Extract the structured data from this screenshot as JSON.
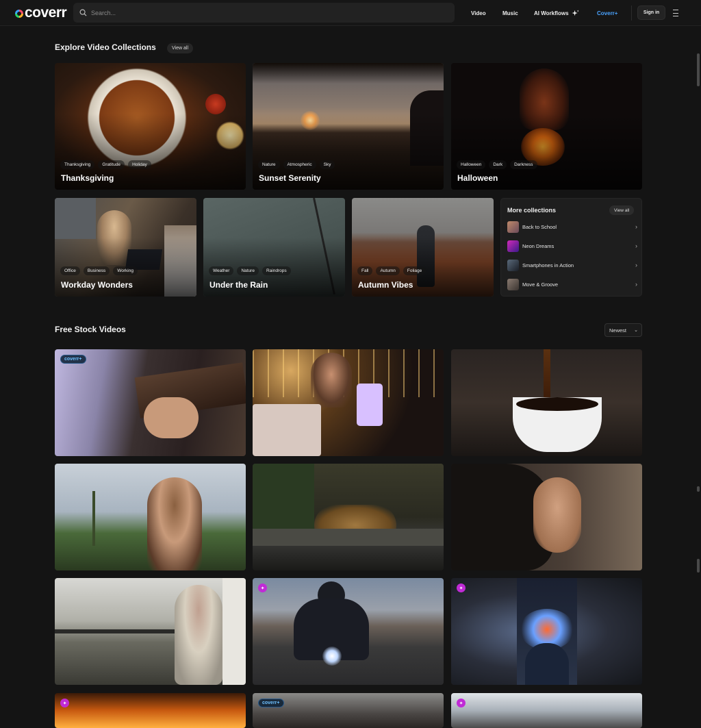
{
  "header": {
    "logo": "coverr",
    "search_placeholder": "Search...",
    "nav": {
      "video": "Video",
      "music": "Music",
      "ai_workflows": "AI Workflows",
      "coverr_plus": "Coverr+"
    },
    "sign_in": "Sign in"
  },
  "collections": {
    "title": "Explore Video Collections",
    "view_all": "View all",
    "cards": [
      {
        "title": "Thanksgiving",
        "tags": [
          "Thanksgiving",
          "Gratitude",
          "Holiday"
        ]
      },
      {
        "title": "Sunset Serenity",
        "tags": [
          "Nature",
          "Atmospheric",
          "Sky"
        ]
      },
      {
        "title": "Halloween",
        "tags": [
          "Halloween",
          "Dark",
          "Darkness"
        ]
      },
      {
        "title": "Workday Wonders",
        "tags": [
          "Office",
          "Business",
          "Working"
        ]
      },
      {
        "title": "Under the Rain",
        "tags": [
          "Weather",
          "Nature",
          "Raindrops"
        ]
      },
      {
        "title": "Autumn Vibes",
        "tags": [
          "Fall",
          "Autumn",
          "Foliage"
        ]
      }
    ],
    "more": {
      "title": "More collections",
      "view_all": "View all",
      "items": [
        {
          "label": "Back to School"
        },
        {
          "label": "Neon Dreams"
        },
        {
          "label": "Smartphones in Action"
        },
        {
          "label": "Move & Groove"
        }
      ]
    }
  },
  "free_videos": {
    "title": "Free Stock Videos",
    "sort_value": "Newest",
    "badge_plus": "coverr+"
  },
  "colors": {
    "accent": "#4aa3ff",
    "ai_badge": "#c02bd6",
    "background": "#141414"
  },
  "icons": [
    "search-icon",
    "sparkle-icon",
    "menu-icon",
    "chevron-right-icon",
    "chevron-down-icon",
    "ai-sparkle-icon"
  ]
}
